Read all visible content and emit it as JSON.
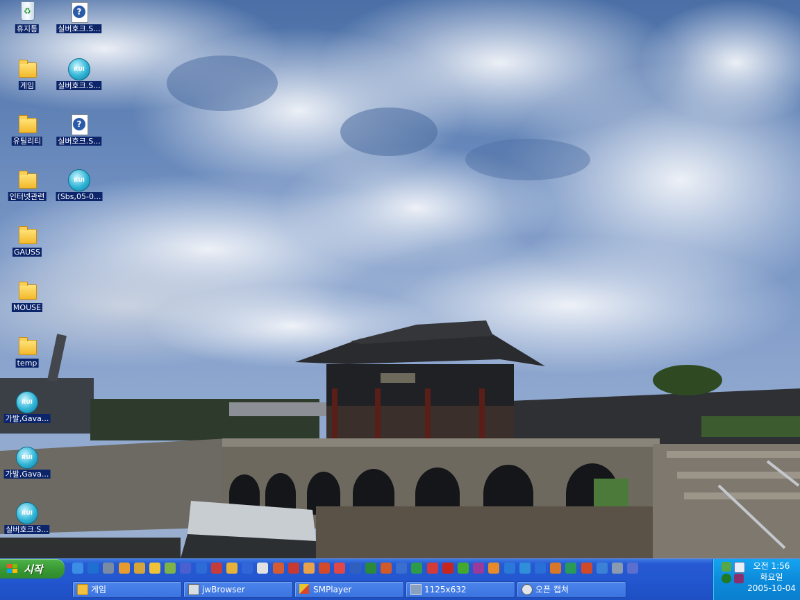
{
  "desktop": {
    "icons_col1": [
      {
        "label": "휴지통",
        "icon": "recycle-bin-icon"
      },
      {
        "label": "게임",
        "icon": "folder-icon"
      },
      {
        "label": "유틸리티",
        "icon": "folder-icon"
      },
      {
        "label": "인터넷관련",
        "icon": "folder-icon"
      },
      {
        "label": "GAUSS",
        "icon": "folder-icon"
      },
      {
        "label": "MOUSE",
        "icon": "folder-icon"
      },
      {
        "label": "temp",
        "icon": "folder-icon"
      },
      {
        "label": "가발,Gava...",
        "icon": "rui-media-icon"
      },
      {
        "label": "가발,Gava...",
        "icon": "rui-media-icon"
      },
      {
        "label": "실버호크.S...",
        "icon": "rui-media-icon"
      }
    ],
    "icons_col2": [
      {
        "label": "실버호크.S...",
        "icon": "realplayer-file-icon"
      },
      {
        "label": "실버호크.S...",
        "icon": "rui-media-icon"
      },
      {
        "label": "실버호크.S...",
        "icon": "realplayer-file-icon"
      },
      {
        "label": "(Sbs,05-0...",
        "icon": "rui-media-icon"
      }
    ],
    "rui_text": "RUI"
  },
  "taskbar": {
    "start_label": "시작",
    "tasks": [
      {
        "label": "게임",
        "icon": "folder-icon"
      },
      {
        "label": "jwBrowser",
        "icon": "browser-icon"
      },
      {
        "label": "SMPlayer",
        "icon": "media-player-icon"
      },
      {
        "label": "1125x632",
        "icon": "image-viewer-icon"
      },
      {
        "label": "오픈 캡쳐",
        "icon": "capture-icon"
      }
    ],
    "quick_launch_count": 37
  },
  "tray": {
    "time": "오전 1:56",
    "day": "화요일",
    "date": "2005-10-04"
  },
  "colors": {
    "taskbar_blue": "#2357d0",
    "start_green": "#3a9a35",
    "tray_blue": "#0d8bdb",
    "icon_label_bg": "#0b246a"
  }
}
